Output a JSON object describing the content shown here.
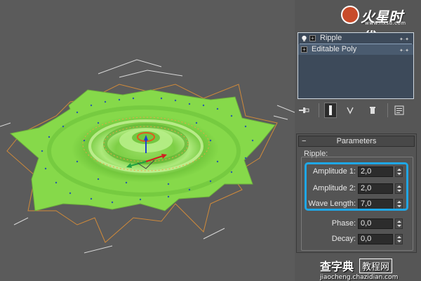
{
  "watermark_top": {
    "brand": "火星时代",
    "url": "www.hxsd.com"
  },
  "modifier_stack": {
    "items": [
      {
        "label": "Ripple",
        "selected": false
      },
      {
        "label": "Editable Poly",
        "selected": true
      }
    ]
  },
  "toolbar": {
    "icons": [
      "pin-stack-icon",
      "show-end-result-icon",
      "make-unique-icon",
      "remove-modifier-icon",
      "configure-modifier-sets-icon"
    ]
  },
  "parameters": {
    "rollout_title": "Parameters",
    "collapse_symbol": "−",
    "group_label": "Ripple:",
    "fields": [
      {
        "label": "Amplitude 1:",
        "value": "2,0"
      },
      {
        "label": "Amplitude 2:",
        "value": "2,0"
      },
      {
        "label": "Wave Length:",
        "value": "7,0"
      },
      {
        "label": "Phase:",
        "value": "0,0"
      },
      {
        "label": "Decay:",
        "value": "0,0"
      }
    ]
  },
  "colors": {
    "highlight": "#1fa7e6",
    "mesh_green": "#86d94a",
    "stack_bg": "#3d4a5a"
  },
  "watermark_bottom": {
    "brand": "查字典",
    "boxed": "教程网",
    "url": "jiaocheng.chazidian.com"
  }
}
